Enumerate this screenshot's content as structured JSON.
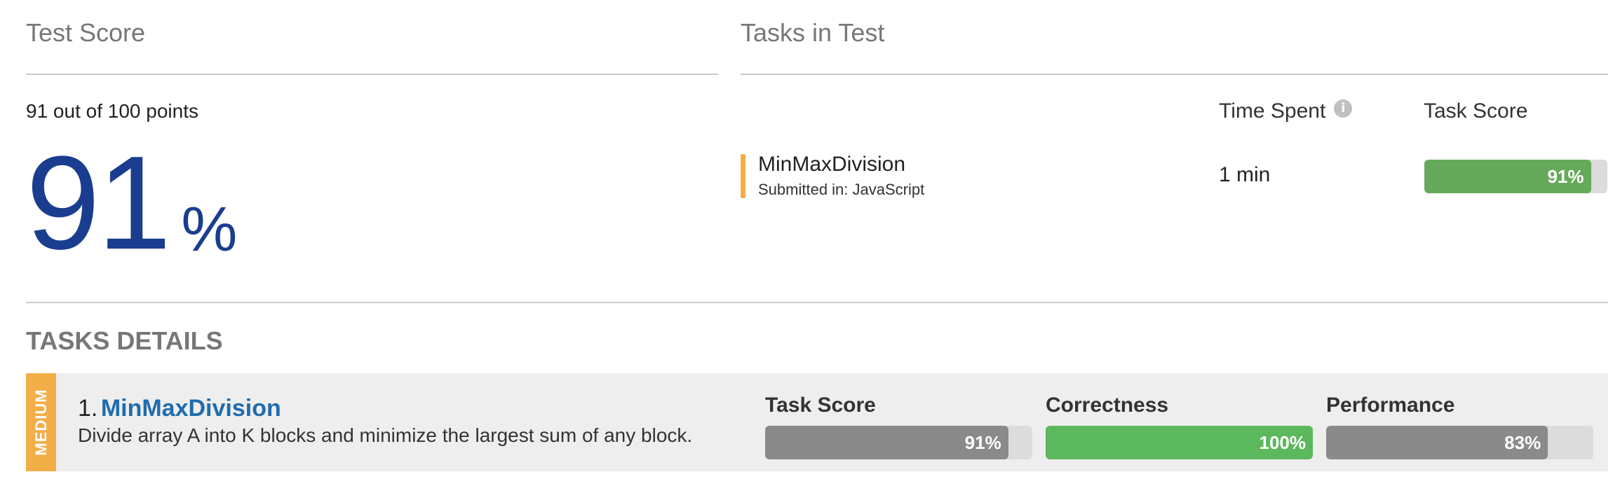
{
  "test_score": {
    "title": "Test Score",
    "points_text": "91 out of 100 points",
    "percent_value": "91",
    "percent_sign": "%"
  },
  "tasks_in_test": {
    "title": "Tasks in Test",
    "columns": {
      "time_spent": "Time Spent",
      "task_score": "Task Score"
    },
    "info_icon": "info-icon",
    "rows": [
      {
        "name": "MinMaxDivision",
        "submitted": "Submitted in: JavaScript",
        "time": "1 min",
        "score_label": "91%",
        "score_fraction": 0.91
      }
    ]
  },
  "tasks_details": {
    "title": "TASKS DETAILS",
    "items": [
      {
        "difficulty": "MEDIUM",
        "number": "1.",
        "name": "MinMaxDivision",
        "description": "Divide array A into K blocks and minimize the largest sum of any block.",
        "metrics": [
          {
            "label": "Task Score",
            "value_label": "91%",
            "fraction": 0.91,
            "color": "#8a8a8a"
          },
          {
            "label": "Correctness",
            "value_label": "100%",
            "fraction": 1.0,
            "color": "#5cb85c"
          },
          {
            "label": "Performance",
            "value_label": "83%",
            "fraction": 0.83,
            "color": "#8a8a8a"
          }
        ]
      }
    ]
  },
  "colors": {
    "score_blue": "#1a3d8f",
    "accent_orange": "#f2ae47",
    "success_green": "#5cb85c",
    "task_score_green": "#66a95a",
    "link_blue": "#1f6cad"
  }
}
